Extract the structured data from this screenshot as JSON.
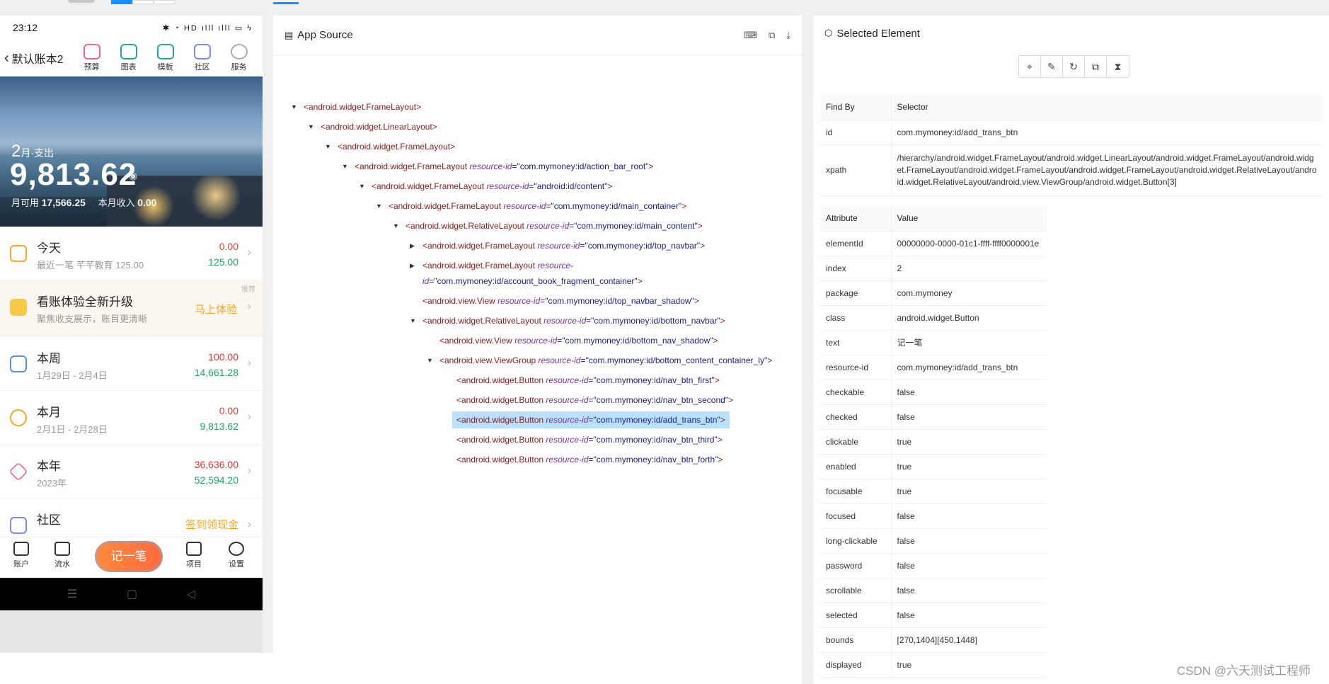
{
  "phone": {
    "status_time": "23:12",
    "status_icons": "✱ ◔ HD ılll ılll ▭ ϟ",
    "book_title": "默认账本2",
    "nav_items": [
      "预算",
      "图表",
      "模板",
      "社区",
      "服务"
    ],
    "hero": {
      "month_num": "2",
      "month_label": "月·支出",
      "amount": "9,813.62",
      "available_label": "月可用",
      "available_value": "17,566.25",
      "income_label": "本月收入",
      "income_value": "0.00"
    },
    "rows": [
      {
        "title": "今天",
        "sub": "最近一笔 芊芊教育 125.00",
        "v1": "0.00",
        "v2": "125.00"
      },
      {
        "title": "看账体验全新升级",
        "sub": "聚焦收支展示，账目更清晰",
        "tag": "推荐",
        "cta": "马上体验"
      },
      {
        "title": "本周",
        "sub": "1月29日 - 2月4日",
        "v1": "100.00",
        "v2": "14,661.28"
      },
      {
        "title": "本月",
        "sub": "2月1日 - 2月28日",
        "v1": "0.00",
        "v2": "9,813.62"
      },
      {
        "title": "本年",
        "sub": "2023年",
        "v1": "36,636.00",
        "v2": "52,594.20"
      },
      {
        "title": "社区",
        "sub": "",
        "cta": "签到领现金"
      }
    ],
    "bottom_nav": [
      "账户",
      "流水",
      "记一笔",
      "项目",
      "设置"
    ],
    "sys_nav": [
      "☰",
      "▢",
      "◁"
    ]
  },
  "source": {
    "title": "App Source",
    "nodes": [
      {
        "tag": "<android.widget.FrameLayout>",
        "attr": "",
        "val": "",
        "tail": ""
      },
      {
        "tag": "<android.widget.LinearLayout>",
        "attr": "",
        "val": "",
        "tail": ""
      },
      {
        "tag": "<android.widget.FrameLayout>",
        "attr": "",
        "val": "",
        "tail": ""
      },
      {
        "tag": "<android.widget.FrameLayout ",
        "attr": "resource-id",
        "val": "=\"com.mymoney:id/action_bar_root\"",
        "tail": ">"
      },
      {
        "tag": "<android.widget.FrameLayout ",
        "attr": "resource-id",
        "val": "=\"android:id/content\"",
        "tail": ">"
      },
      {
        "tag": "<android.widget.FrameLayout ",
        "attr": "resource-id",
        "val": "=\"com.mymoney:id/main_container\"",
        "tail": ">"
      },
      {
        "tag": "<android.widget.RelativeLayout ",
        "attr": "resource-id",
        "val": "=\"com.mymoney:id/main_content\"",
        "tail": ">"
      },
      {
        "tag": "<android.widget.FrameLayout ",
        "attr": "resource-id",
        "val": "=\"com.mymoney:id/top_navbar\"",
        "tail": ">"
      },
      {
        "tag": "<android.widget.FrameLayout ",
        "attr": "resource-",
        "val": "",
        "tail": ""
      },
      {
        "tag": "",
        "attr": "id",
        "val": "=\"com.mymoney:id/account_book_fragment_container\"",
        "tail": ">"
      },
      {
        "tag": "<android.view.View ",
        "attr": "resource-id",
        "val": "=\"com.mymoney:id/top_navbar_shadow\"",
        "tail": ">"
      },
      {
        "tag": "<android.widget.RelativeLayout ",
        "attr": "resource-id",
        "val": "=\"com.mymoney:id/bottom_navbar\"",
        "tail": ">"
      },
      {
        "tag": "<android.view.View ",
        "attr": "resource-id",
        "val": "=\"com.mymoney:id/bottom_nav_shadow\"",
        "tail": ">"
      },
      {
        "tag": "<android.view.ViewGroup ",
        "attr": "resource-id",
        "val": "=\"com.mymoney:id/bottom_content_container_ly\"",
        "tail": ">"
      },
      {
        "tag": "<android.widget.Button ",
        "attr": "resource-id",
        "val": "=\"com.mymoney:id/nav_btn_first\"",
        "tail": ">"
      },
      {
        "tag": "<android.widget.Button ",
        "attr": "resource-id",
        "val": "=\"com.mymoney:id/nav_btn_second\"",
        "tail": ">"
      },
      {
        "tag": "<android.widget.Button ",
        "attr": "resource-id",
        "val": "=\"com.mymoney:id/add_trans_btn\"",
        "tail": ">"
      },
      {
        "tag": "<android.widget.Button ",
        "attr": "resource-id",
        "val": "=\"com.mymoney:id/nav_btn_third\"",
        "tail": ">"
      },
      {
        "tag": "<android.widget.Button ",
        "attr": "resource-id",
        "val": "=\"com.mymoney:id/nav_btn_forth\"",
        "tail": ">"
      }
    ]
  },
  "selected": {
    "title": "Selected Element",
    "selector_headers": [
      "Find By",
      "Selector"
    ],
    "selectors": [
      {
        "k": "id",
        "v": "com.mymoney:id/add_trans_btn"
      },
      {
        "k": "xpath",
        "v": "/hierarchy/android.widget.FrameLayout/android.widget.LinearLayout/android.widget.FrameLayout/android.widget.FrameLayout/android.widget.FrameLayout/android.widget.FrameLayout/android.widget.RelativeLayout/android.widget.RelativeLayout/android.view.ViewGroup/android.widget.Button[3]"
      }
    ],
    "attr_headers": [
      "Attribute",
      "Value"
    ],
    "attributes": [
      {
        "k": "elementId",
        "v": "00000000-0000-01c1-ffff-ffff0000001e"
      },
      {
        "k": "index",
        "v": "2"
      },
      {
        "k": "package",
        "v": "com.mymoney"
      },
      {
        "k": "class",
        "v": "android.widget.Button"
      },
      {
        "k": "text",
        "v": "记一笔"
      },
      {
        "k": "resource-id",
        "v": "com.mymoney:id/add_trans_btn"
      },
      {
        "k": "checkable",
        "v": "false"
      },
      {
        "k": "checked",
        "v": "false"
      },
      {
        "k": "clickable",
        "v": "true"
      },
      {
        "k": "enabled",
        "v": "true"
      },
      {
        "k": "focusable",
        "v": "true"
      },
      {
        "k": "focused",
        "v": "false"
      },
      {
        "k": "long-clickable",
        "v": "false"
      },
      {
        "k": "password",
        "v": "false"
      },
      {
        "k": "scrollable",
        "v": "false"
      },
      {
        "k": "selected",
        "v": "false"
      },
      {
        "k": "bounds",
        "v": "[270,1404][450,1448]"
      },
      {
        "k": "displayed",
        "v": "true"
      }
    ]
  },
  "watermark": "CSDN @六天测试工程师",
  "colors": {
    "accent": "#1890ff",
    "highlight": "#bae0ff",
    "expense": "#e53935",
    "income": "#20a565",
    "cta": "#f5a623"
  }
}
